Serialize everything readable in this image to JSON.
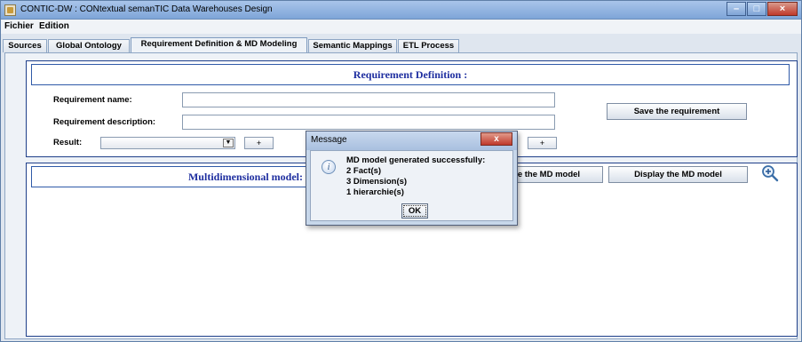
{
  "window": {
    "title": "CONTIC-DW : CONtextual semanTIC Data Warehouses Design",
    "controls": {
      "minimize": "–",
      "maximize": "□",
      "close": "×"
    }
  },
  "menubar": {
    "items": [
      "Fichier",
      "Edition"
    ]
  },
  "tabs": [
    {
      "label": "Sources",
      "active": false
    },
    {
      "label": "Global Ontology",
      "active": false
    },
    {
      "label": "Requirement Definition & MD Modeling",
      "active": true
    },
    {
      "label": "Semantic Mappings",
      "active": false
    },
    {
      "label": "ETL Process",
      "active": false
    }
  ],
  "requirement_panel": {
    "header": "Requirement Definition :",
    "name_label": "Requirement name:",
    "name_value": "",
    "description_label": "Requirement description:",
    "description_value": "",
    "result_label": "Result:",
    "result_selected": "",
    "add_label": "+",
    "add_right_label": "+",
    "save_button": "Save the requirement"
  },
  "md_panel": {
    "header": "Multidimensional model:",
    "generate_button": "Generate the MD model",
    "display_button": "Display the MD model",
    "zoom_icon": "zoom-in-icon"
  },
  "dialog": {
    "title": "Message",
    "close": "x",
    "icon": "info-icon",
    "lines": [
      "MD model generated successfully:",
      "2 Fact(s)",
      "3 Dimension(s)",
      "1 hierarchie(s)"
    ],
    "ok_button": "OK"
  },
  "colors": {
    "header_text": "#1f2fa0",
    "panel_border": "#1f3f8a",
    "titlebar": "#7ea5d8"
  }
}
